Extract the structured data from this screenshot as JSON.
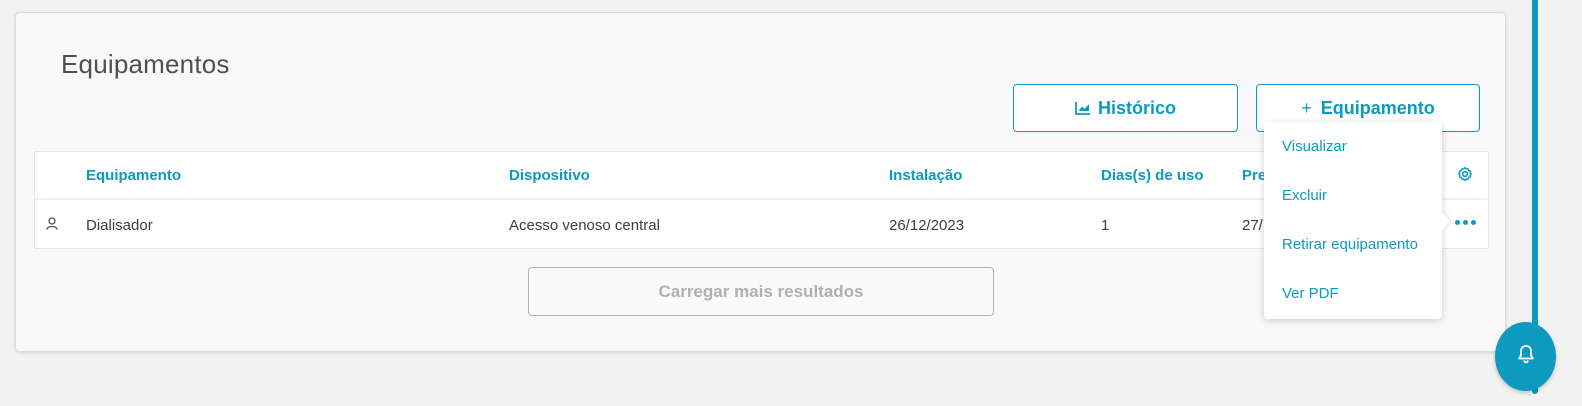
{
  "page": {
    "title": "Equipamentos"
  },
  "toolbar": {
    "historico_label": "Histórico",
    "historico_icon": "area-chart-icon",
    "add_equipment_label": "Equipamento",
    "add_equipment_prefix": "+"
  },
  "table": {
    "columns": [
      "Equipamento",
      "Dispositivo",
      "Instalação",
      "Dias(s) de uso",
      "Pre"
    ],
    "rows": [
      {
        "icon": "person-icon",
        "equipamento": "Dialisador",
        "dispositivo": "Acesso venoso central",
        "instalacao": "26/12/2023",
        "dias_uso": "1",
        "previsao": "27/"
      }
    ]
  },
  "load_more": {
    "label": "Carregar mais resultados"
  },
  "actions_menu": {
    "items": [
      "Visualizar",
      "Excluir",
      "Retirar equipamento",
      "Ver PDF"
    ]
  },
  "colors": {
    "accent": "#0c9abe",
    "text": "#3d3d3d",
    "disabled": "#b0b0b0"
  }
}
